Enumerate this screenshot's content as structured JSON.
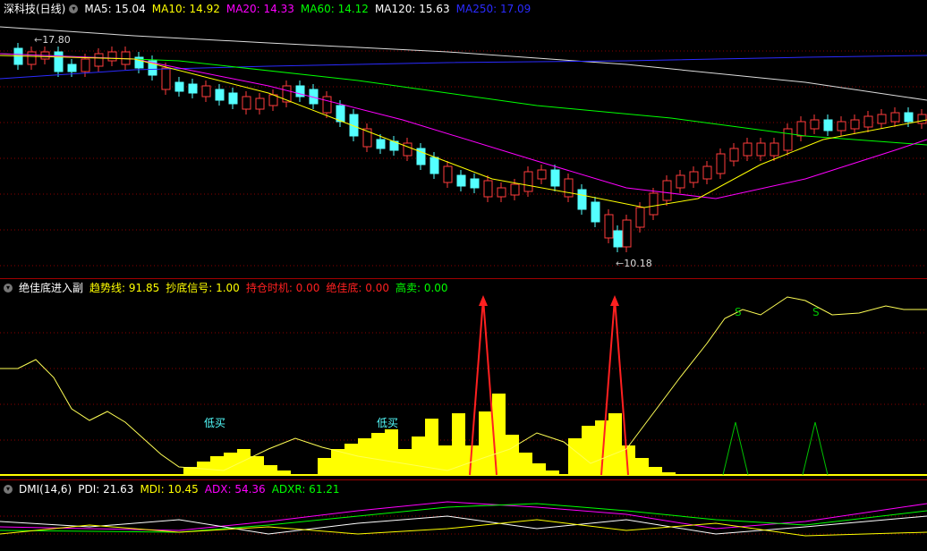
{
  "main": {
    "title": "深科技(日线)",
    "ma_items": [
      {
        "label": "MA5: 15.04",
        "color": "#ffffff"
      },
      {
        "label": "MA10: 14.92",
        "color": "#ffff00"
      },
      {
        "label": "MA20: 14.33",
        "color": "#ff00ff"
      },
      {
        "label": "MA60: 14.12",
        "color": "#00ff00"
      },
      {
        "label": "MA120: 15.63",
        "color": "#ffffff"
      },
      {
        "label": "MA250: 17.09",
        "color": "#0000ff"
      }
    ],
    "high_label": "17.80",
    "low_label": "10.18"
  },
  "indicator": {
    "title": "绝佳底进入副",
    "items": [
      {
        "label": "趋势线: 91.85",
        "color": "#ffff00"
      },
      {
        "label": "抄底信号: 1.00",
        "color": "#ffff00"
      },
      {
        "label": "持仓时机: 0.00",
        "color": "#ff2020"
      },
      {
        "label": "绝佳底: 0.00",
        "color": "#ff2020"
      },
      {
        "label": "高卖: 0.00",
        "color": "#00ff00"
      }
    ],
    "annotations": {
      "low_buy": "低买",
      "sell_mark": "S"
    }
  },
  "dmi": {
    "title": "DMI(14,6)",
    "items": [
      {
        "label": "PDI: 21.63",
        "color": "#ffffff"
      },
      {
        "label": "MDI: 10.45",
        "color": "#ffff00"
      },
      {
        "label": "ADX: 54.36",
        "color": "#ff00ff"
      },
      {
        "label": "ADXR: 61.21",
        "color": "#00ff00"
      }
    ]
  },
  "colors": {
    "up": "#ff3c3c",
    "down": "#54ffff",
    "grid": "#8b0000"
  }
}
